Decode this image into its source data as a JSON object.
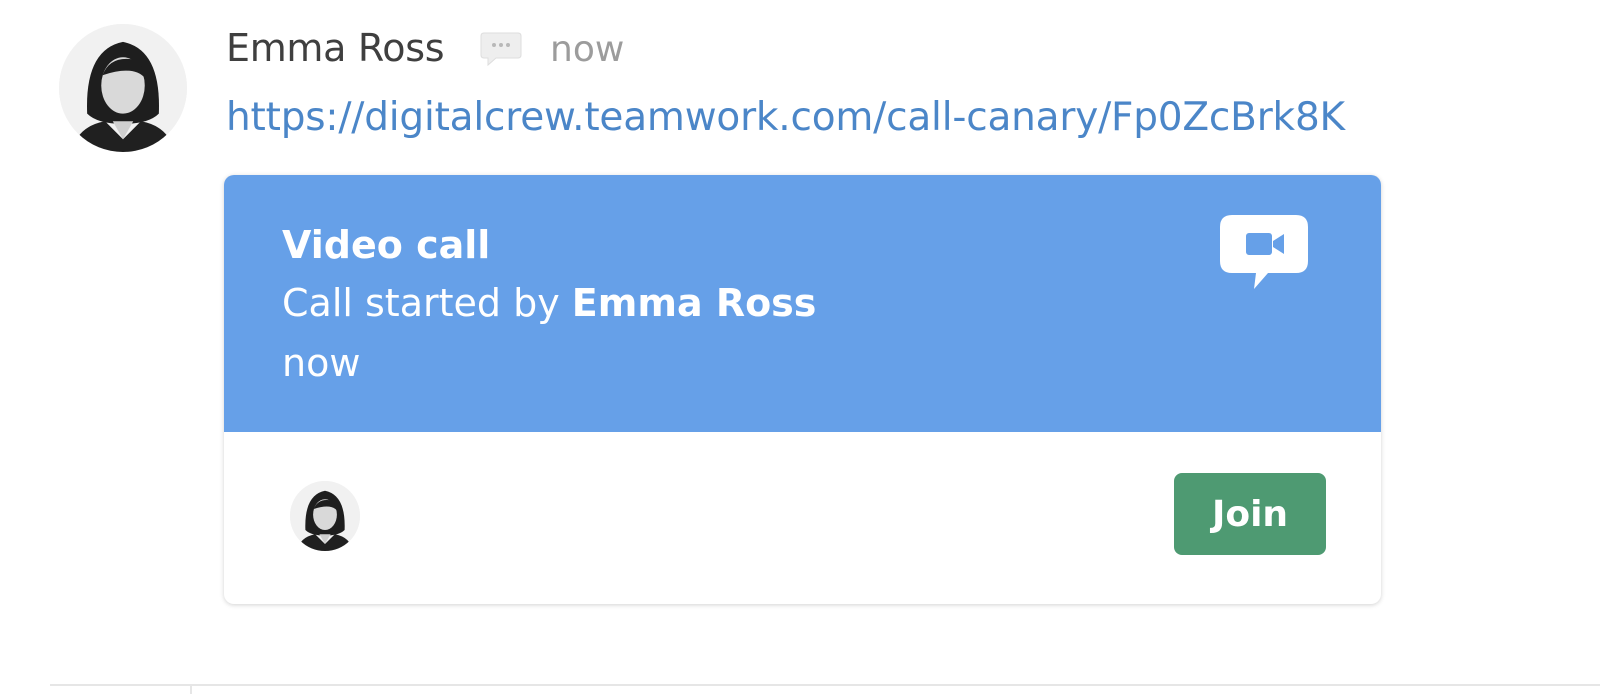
{
  "message": {
    "sender_name": "Emma Ross",
    "timestamp": "now",
    "link_text": "https://digitalcrew.teamwork.com/call-canary/Fp0ZcBrk8K"
  },
  "call_card": {
    "title": "Video call",
    "started_by_prefix": "Call started by ",
    "started_by_name": "Emma Ross",
    "time": "now",
    "join_label": "Join"
  },
  "icons": {
    "chat": "chat-bubble-icon",
    "video": "video-camera-icon"
  },
  "colors": {
    "card_header": "#66a0e8",
    "link": "#4b86c8",
    "join_button": "#4e9a72"
  }
}
